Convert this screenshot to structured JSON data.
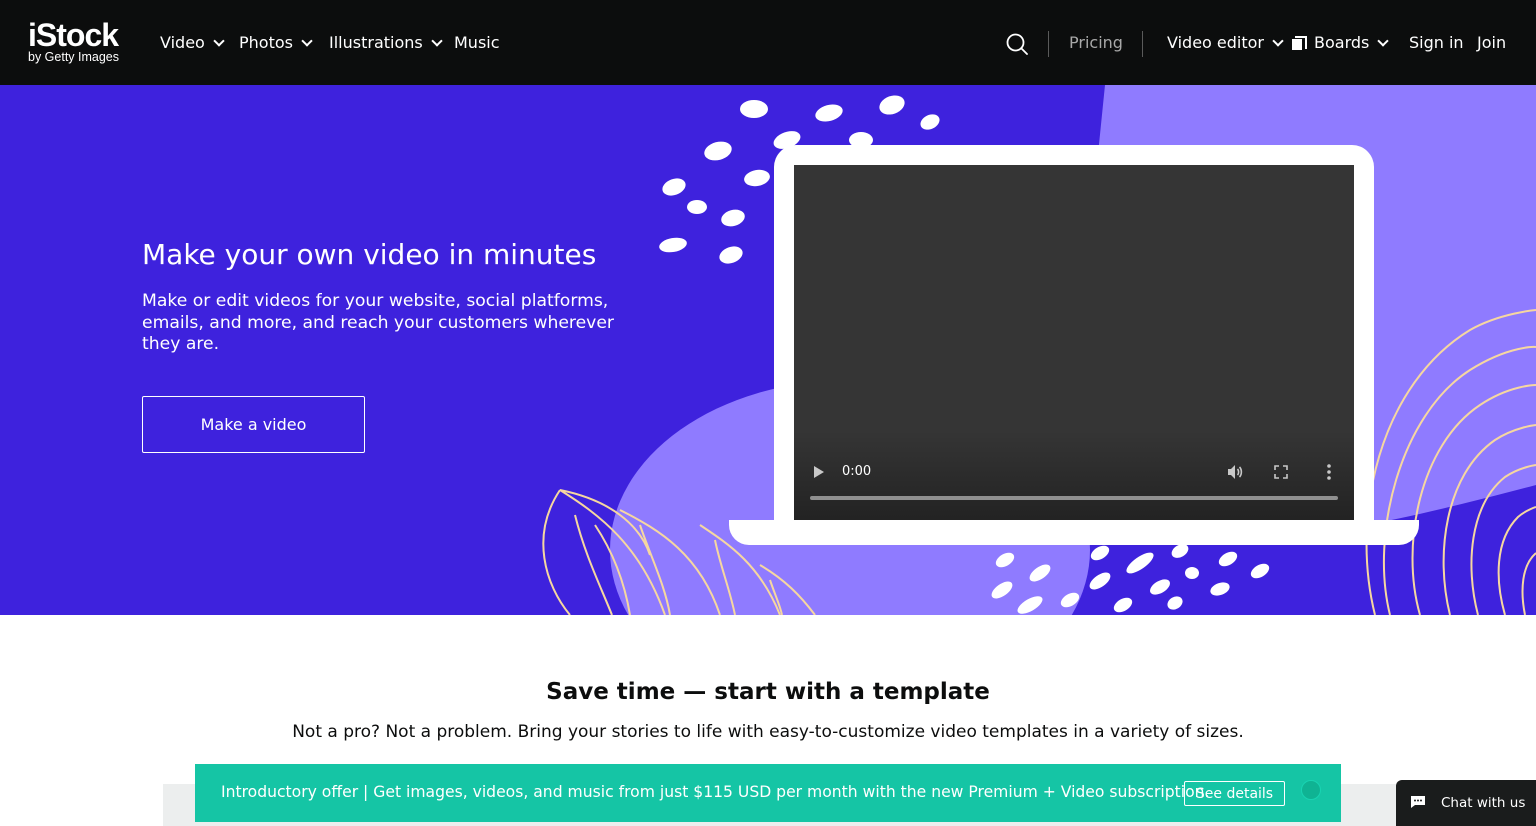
{
  "nav": {
    "logo_brand": "iStock",
    "logo_sub": "by Getty Images",
    "video": "Video",
    "photos": "Photos",
    "illustrations": "Illustrations",
    "music": "Music",
    "pricing": "Pricing",
    "video_editor": "Video editor",
    "boards": "Boards",
    "sign_in": "Sign in",
    "join": "Join"
  },
  "hero": {
    "title": "Make your own video in minutes",
    "subtitle": "Make or edit videos for your website, social platforms, emails, and more, and reach your customers wherever they are.",
    "cta": "Make a video",
    "video_time": "0:00",
    "video_progress": 0,
    "background_color": "#3e22dd",
    "accent_color": "#8f7bff"
  },
  "templates": {
    "title": "Save time — start with a template",
    "subtitle": "Not a pro? Not a problem. Bring your stories to life with easy-to-customize video templates in a variety of sizes."
  },
  "offer": {
    "text": "Introductory offer | Get images, videos, and music from just $115 USD per month with the new Premium + Video subscription.",
    "button": "See details",
    "color": "#15c5a5"
  },
  "chat": {
    "label": "Chat with us"
  }
}
